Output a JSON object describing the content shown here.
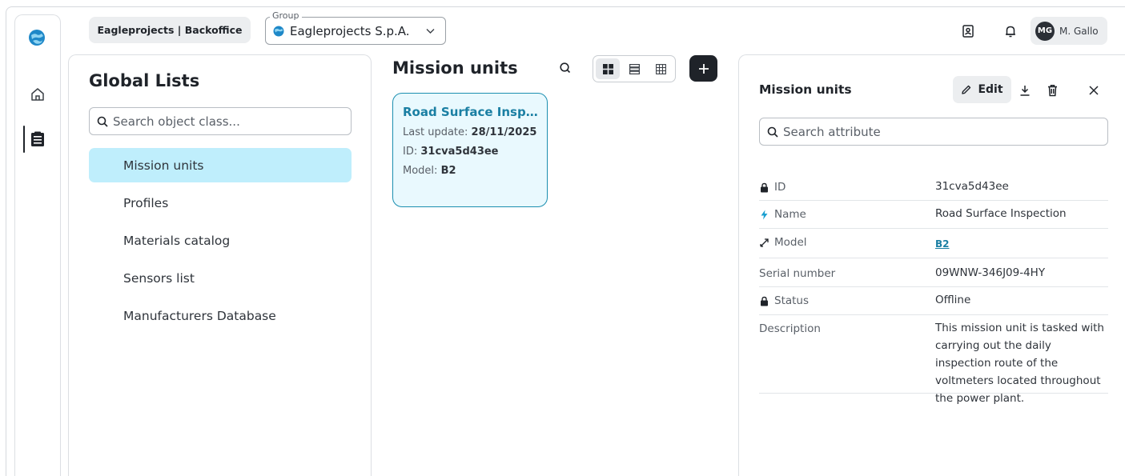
{
  "topbar": {
    "brand_label": "Eagleprojects | Backoffice",
    "group_label": "Group",
    "group_value": "Eagleprojects S.p.A.",
    "user_initials": "MG",
    "user_name": "M. Gallo"
  },
  "global_lists": {
    "title": "Global Lists",
    "search_placeholder": "Search object class...",
    "items": [
      {
        "label": "Mission units",
        "active": true
      },
      {
        "label": "Profiles"
      },
      {
        "label": "Materials catalog"
      },
      {
        "label": "Sensors list"
      },
      {
        "label": "Manufacturers Database"
      }
    ]
  },
  "mission_units": {
    "title": "Mission units",
    "card": {
      "title": "Road Surface Inspect...",
      "last_update_label": "Last update:",
      "last_update_value": "28/11/2025",
      "id_label": "ID:",
      "id_value": "31cva5d43ee",
      "model_label": "Model:",
      "model_value": "B2"
    }
  },
  "detail": {
    "title": "Mission units",
    "edit_label": "Edit",
    "search_placeholder": "Search attribute",
    "attributes": [
      {
        "key": "ID",
        "icon": "lock-icon",
        "value": "31cva5d43ee"
      },
      {
        "key": "Name",
        "icon": "bolt-icon",
        "value": "Road Surface Inspection"
      },
      {
        "key": "Model",
        "icon": "link-arrows-icon",
        "value": "B2"
      },
      {
        "key": "Serial number",
        "icon": "",
        "value": "09WNW-346J09-4HY"
      },
      {
        "key": "Status",
        "icon": "lock-icon",
        "value": "Offline"
      },
      {
        "key": "Description",
        "icon": "",
        "value": "This mission unit is tasked with carrying out the daily inspection route of the voltmeters located throughout the power plant."
      }
    ]
  },
  "colors": {
    "accent": "#1a7fa3",
    "active_item_bg": "#bfeefc",
    "card_bg": "#e9f9fe",
    "dark": "#1f2329"
  }
}
